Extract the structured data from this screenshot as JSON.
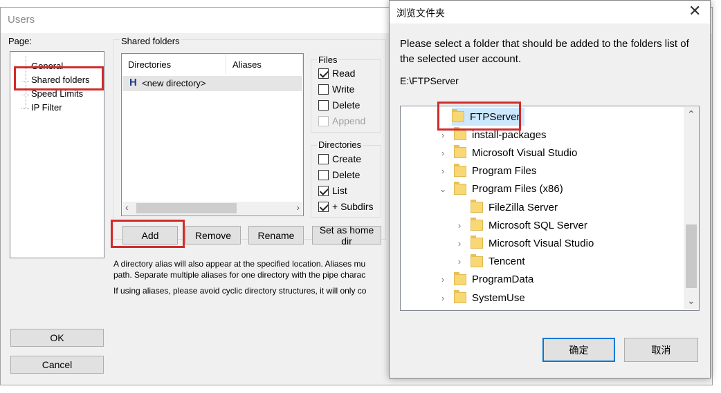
{
  "users_dialog": {
    "title": "Users",
    "page_label": "Page:",
    "pages": [
      "General",
      "Shared folders",
      "Speed Limits",
      "IP Filter"
    ],
    "selected_page": "Shared folders",
    "shared_folders_label": "Shared folders",
    "columns": [
      "Directories",
      "Aliases"
    ],
    "directories": [
      {
        "icon": "H",
        "name": "<new directory>"
      }
    ],
    "files_group": {
      "title": "Files",
      "options": [
        {
          "label": "Read",
          "checked": true,
          "disabled": false
        },
        {
          "label": "Write",
          "checked": false,
          "disabled": false
        },
        {
          "label": "Delete",
          "checked": false,
          "disabled": false
        },
        {
          "label": "Append",
          "checked": false,
          "disabled": true
        }
      ]
    },
    "directories_group": {
      "title": "Directories",
      "options": [
        {
          "label": "Create",
          "checked": false
        },
        {
          "label": "Delete",
          "checked": false
        },
        {
          "label": "List",
          "checked": true
        },
        {
          "label": "+ Subdirs",
          "checked": true
        }
      ]
    },
    "buttons": {
      "add": "Add",
      "remove": "Remove",
      "rename": "Rename",
      "set_home": "Set as home dir",
      "ok": "OK",
      "cancel": "Cancel"
    },
    "help_lines": [
      "A directory alias will also appear at the specified location. Aliases mu",
      "path. Separate multiple aliases for one directory with the pipe charac",
      "If using aliases, please avoid cyclic directory structures, it will only co"
    ]
  },
  "browse_dialog": {
    "title": "浏览文件夹",
    "instructions": "Please select a folder that should be added to the folders list of the selected user account.",
    "current_path": "E:\\FTPServer",
    "folders": [
      {
        "name": "FTPServer",
        "expander": "",
        "selected": true
      },
      {
        "name": "install-packages",
        "expander": "›",
        "selected": false
      },
      {
        "name": "Microsoft Visual Studio",
        "expander": "›",
        "selected": false
      },
      {
        "name": "Program Files",
        "expander": "›",
        "selected": false
      },
      {
        "name": "Program Files (x86)",
        "expander": "⌄",
        "selected": false
      },
      {
        "name": "FileZilla Server",
        "expander": "",
        "selected": false
      },
      {
        "name": "Microsoft SQL Server",
        "expander": "›",
        "selected": false
      },
      {
        "name": "Microsoft Visual Studio",
        "expander": "›",
        "selected": false
      },
      {
        "name": "Tencent",
        "expander": "›",
        "selected": false
      },
      {
        "name": "ProgramData",
        "expander": "›",
        "selected": false
      },
      {
        "name": "SystemUse",
        "expander": "›",
        "selected": false
      }
    ],
    "ok_label": "确定",
    "cancel_label": "取消",
    "close_glyph": "✕"
  },
  "colors": {
    "highlight": "#d12a2a",
    "accent": "#0078d7",
    "selection": "#cce8ff"
  }
}
